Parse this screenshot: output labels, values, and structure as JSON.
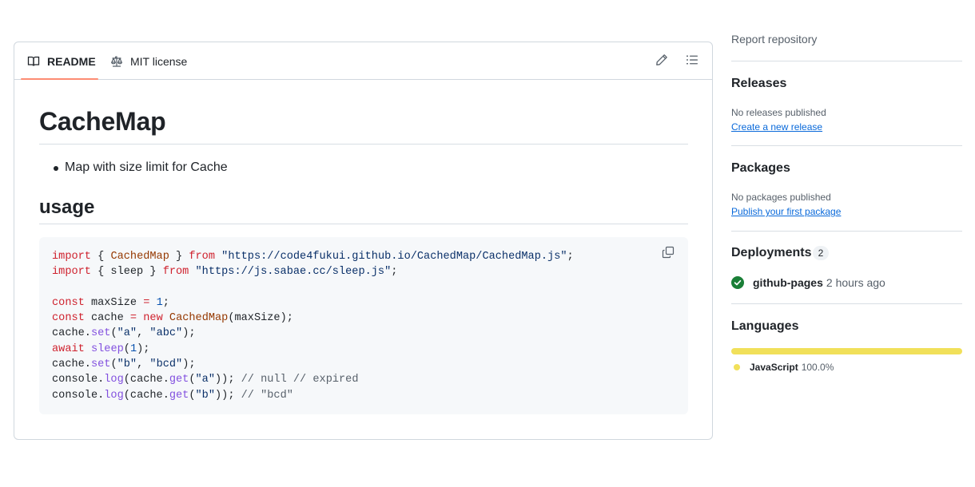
{
  "readme": {
    "tabs": [
      {
        "label": "README",
        "icon": "book-icon",
        "selected": true
      },
      {
        "label": "MIT license",
        "icon": "law-icon",
        "selected": false
      }
    ],
    "title": "CacheMap",
    "bullets": [
      "Map with size limit for Cache"
    ],
    "section_heading": "usage",
    "code_lines": [
      "import { CachedMap } from \"https://code4fukui.github.io/CachedMap/CachedMap.js\";",
      "import { sleep } from \"https://js.sabae.cc/sleep.js\";",
      "",
      "const maxSize = 1;",
      "const cache = new CachedMap(maxSize);",
      "cache.set(\"a\", \"abc\");",
      "await sleep(1);",
      "cache.set(\"b\", \"bcd\");",
      "console.log(cache.get(\"a\")); // null // expired",
      "console.log(cache.get(\"b\")); // \"bcd\""
    ]
  },
  "sidebar": {
    "report": "Report repository",
    "releases": {
      "heading": "Releases",
      "empty_text": "No releases published",
      "link": "Create a new release"
    },
    "packages": {
      "heading": "Packages",
      "empty_text": "No packages published",
      "link": "Publish your first package"
    },
    "deployments": {
      "heading": "Deployments",
      "count": "2",
      "items": [
        {
          "name": "github-pages",
          "time": "2 hours ago",
          "status": "success"
        }
      ]
    },
    "languages": {
      "heading": "Languages",
      "items": [
        {
          "name": "JavaScript",
          "percent": "100.0%",
          "share": 100,
          "color": "#f1e05a"
        }
      ]
    }
  },
  "colors": {
    "tab_underline": "#fd8c73",
    "link": "#0969da",
    "success": "#1a7f37",
    "javascript": "#f1e05a"
  }
}
